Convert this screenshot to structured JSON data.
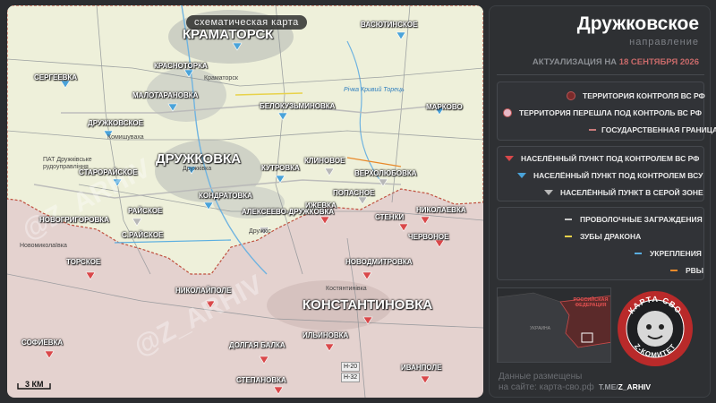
{
  "map": {
    "title": "схематическая карта",
    "scale": "3 КМ",
    "watermarks": [
      "@Z_ARHIV",
      "@Z_ARHIV"
    ],
    "cities_large": [
      "Краматорск",
      "Дружковка",
      "Константиновка"
    ],
    "cities": [
      "Сергеевка",
      "Красноторка",
      "Малотарановка",
      "Дружковское",
      "Старорайское",
      "Васютинское",
      "Белокузьминовка",
      "Марково",
      "Кутровка",
      "Клиновое",
      "Верхолюбовка",
      "Кондратовка",
      "Ижевка",
      "Попасное",
      "Стенки",
      "Николаевка",
      "Новогригоровка",
      "Райское",
      "Алексеево-Дружковка",
      "С.Райское",
      "Червоное",
      "Торское",
      "Новодмитровка",
      "Николайполе",
      "Софиевка",
      "Долгая Балка",
      "Ильиновка",
      "Степановка",
      "Иванполе"
    ],
    "sublabels": [
      "Краматорск",
      "Комишуваха",
      "Дружківка",
      "Костянтинівка",
      "Новомиколаївка",
      "Дружкіс",
      "ПАТ Дружківське рудоуправління"
    ],
    "water": [
      "Річка Кривий Торець"
    ],
    "roads": [
      "Н-20",
      "Н-32"
    ]
  },
  "panel": {
    "title": "Дружковское",
    "subtitle": "направление",
    "update_prefix": "АКТУАЛИЗАЦИЯ НА",
    "update_date": "18 СЕНТЯБРЯ 2026",
    "legend_territory": [
      {
        "label": "ТЕРРИТОРИЯ КОНТРОЛЯ ВС РФ",
        "color": "#7a2a2a",
        "icon": "circle-icon"
      },
      {
        "label": "ТЕРРИТОРИЯ ПЕРЕШЛА ПОД КОНТРОЛЬ ВС РФ",
        "color": "#e7b9c6",
        "icon": "circle-icon"
      },
      {
        "label": "ГОСУДАРСТВЕННАЯ ГРАНИЦА",
        "color": "#c87a7a",
        "icon": "line-icon"
      }
    ],
    "legend_settlements": [
      {
        "label": "НАСЕЛЁННЫЙ ПУНКТ ПОД КОНТРОЛЕМ ВС РФ",
        "color": "#d9484a",
        "icon": "triangle-icon"
      },
      {
        "label": "НАСЕЛЁННЫЙ ПУНКТ ПОД КОНТРОЛЕМ ВСУ",
        "color": "#4aa3d9",
        "icon": "triangle-icon"
      },
      {
        "label": "НАСЕЛЁННЫЙ ПУНКТ В СЕРОЙ ЗОНЕ",
        "color": "#b8b8b8",
        "icon": "triangle-icon"
      }
    ],
    "legend_fortifications": [
      {
        "label": "ПРОВОЛОЧНЫЕ ЗАГРАЖДЕНИЯ",
        "color": "#c8c8c8",
        "icon": "line-icon"
      },
      {
        "label": "ЗУБЫ ДРАКОНА",
        "color": "#e8d24a",
        "icon": "line-icon"
      },
      {
        "label": "УКРЕПЛЕНИЯ",
        "color": "#5aaee0",
        "icon": "line-icon"
      },
      {
        "label": "РВЫ",
        "color": "#e8892a",
        "icon": "line-icon"
      }
    ],
    "minimap": {
      "label1": "РОССИЙСКАЯ ФЕДЕРАЦИЯ",
      "label2": "УКРАИНА"
    },
    "emblem": {
      "top": "КАРТА СВО",
      "bottom": "Z-КОМИТЕТ"
    },
    "footer_line1": "Данные размещены",
    "footer_line2": "на сайте: карта-сво.рф",
    "handle_prefix": "T.ME/",
    "handle": "Z_ARHIV"
  }
}
